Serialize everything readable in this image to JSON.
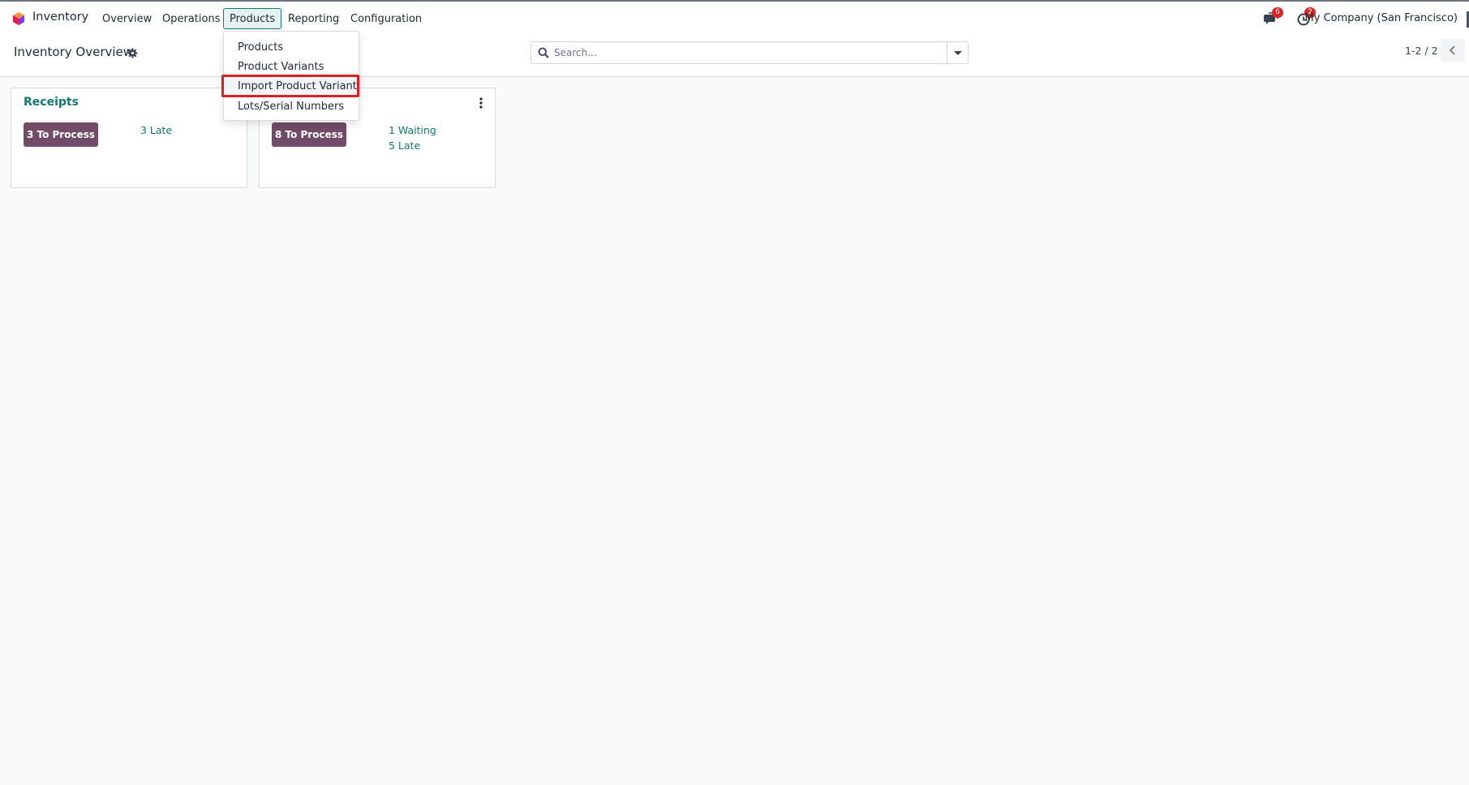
{
  "navbar": {
    "app_name": "Inventory",
    "menu": [
      "Overview",
      "Operations",
      "Products",
      "Reporting",
      "Configuration"
    ],
    "active_menu": "Products",
    "messages_count": "6",
    "activities_count": "2",
    "company": "My Company (San Francisco)"
  },
  "control_panel": {
    "title": "Inventory Overview",
    "search_placeholder": "Search...",
    "pager": "1-2 / 2"
  },
  "products_dropdown": {
    "items": [
      "Products",
      "Product Variants",
      "Import Product Variant",
      "Lots/Serial Numbers"
    ],
    "highlighted_item": "Import Product Variant"
  },
  "cards": [
    {
      "title": "Receipts",
      "process_label": "3 To Process",
      "stats": [
        "3 Late"
      ]
    },
    {
      "title": "",
      "process_label": "8 To Process",
      "stats": [
        "1 Waiting",
        "5 Late"
      ]
    }
  ],
  "colors": {
    "brand": "#714b67",
    "accent": "#0f7a7a",
    "highlight_border": "#e11d24",
    "badge": "#dc2626"
  }
}
